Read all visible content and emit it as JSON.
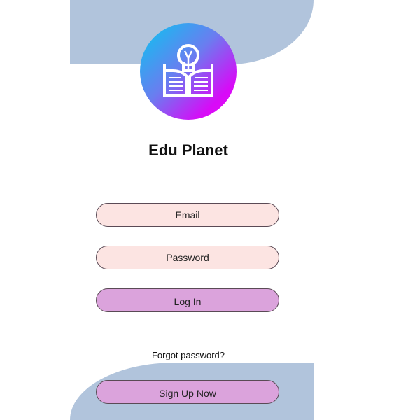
{
  "app": {
    "title": "Edu Planet",
    "logo_icon": "book-lightbulb-icon"
  },
  "login_form": {
    "email_placeholder": "Email",
    "password_placeholder": "Password",
    "login_label": "Log In",
    "forgot_password_label": "Forgot password?",
    "signup_label": "Sign Up Now"
  },
  "colors": {
    "background_blob": "#b1c4dc",
    "input_fill": "#fce4e2",
    "button_fill": "#dba3dc",
    "logo_gradient_start": "#06c8f0",
    "logo_gradient_end": "#e60af5"
  }
}
